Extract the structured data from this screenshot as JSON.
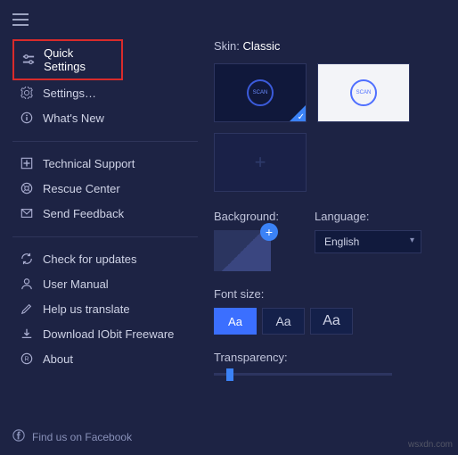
{
  "menu": {
    "quick_settings": "Quick Settings",
    "settings": "Settings…",
    "whats_new": "What's New",
    "tech_support": "Technical Support",
    "rescue_center": "Rescue Center",
    "send_feedback": "Send Feedback",
    "check_updates": "Check for updates",
    "user_manual": "User Manual",
    "help_translate": "Help us translate",
    "download_freeware": "Download IObit Freeware",
    "about": "About"
  },
  "content": {
    "skin_label": "Skin: ",
    "skin_value": "Classic",
    "scan_text": "SCAN",
    "background_label": "Background:",
    "language_label": "Language:",
    "language_value": "English",
    "font_size_label": "Font size:",
    "font_aa": "Aa",
    "transparency_label": "Transparency:"
  },
  "footer": {
    "facebook": "Find us on Facebook"
  },
  "watermark": "wsxdn.com"
}
